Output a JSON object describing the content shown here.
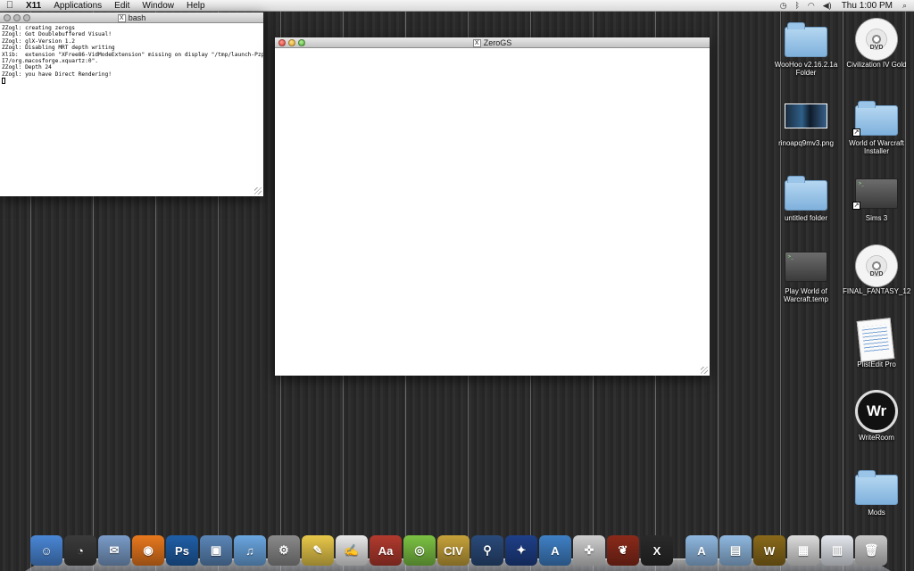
{
  "menubar": {
    "app": "X11",
    "items": [
      "Applications",
      "Edit",
      "Window",
      "Help"
    ],
    "clock": "Thu 1:00 PM"
  },
  "terminal": {
    "title": "bash",
    "lines": [
      "ZZogl: creating zerogs",
      "ZZogl: Got Doublebuffered Visual!",
      "ZZogl: glX-Version 1.2",
      "ZZogl: Disabling MRT depth writing",
      "Xlib:  extension \"XFree86-VidModeExtension\" missing on display \"/tmp/launch-Pzpp",
      "I7/org.macosforge.xquartz:0\".",
      "ZZogl: Depth 24",
      "ZZogl: you have Direct Rendering!"
    ]
  },
  "zerogs": {
    "title": "ZeroGS"
  },
  "desktop_icons": [
    {
      "label": "WooHoo v2.16.2.1a Folder",
      "icon": "folder-icon"
    },
    {
      "label": "Civilization IV Gold",
      "icon": "dvd-icon"
    },
    {
      "label": "rinoapq9mv3.png",
      "icon": "image-file-icon"
    },
    {
      "label": "World of Warcraft Installer",
      "icon": "folder-alias-icon"
    },
    {
      "label": "untitled folder",
      "icon": "folder-icon"
    },
    {
      "label": "Sims 3",
      "icon": "terminal-alias-icon"
    },
    {
      "label": "Play World of Warcraft.temp",
      "icon": "terminal-icon"
    },
    {
      "label": "FINAL_FANTASY_12",
      "icon": "dvd-icon"
    },
    {
      "label": "PlistEdit Pro",
      "icon": "plistedit-icon"
    },
    {
      "label": "WriteRoom",
      "icon": "writeroom-icon"
    },
    {
      "label": "Mods",
      "icon": "folder-icon"
    }
  ],
  "icon_text": {
    "dvd": "DVD",
    "writeroom": "Wr",
    "alias": "↗"
  },
  "dock": [
    {
      "name": "finder-icon",
      "color": "#4a87d6",
      "glyph": "☺"
    },
    {
      "name": "dashboard-icon",
      "color": "#3b3b3b",
      "glyph": "◔"
    },
    {
      "name": "mail-icon",
      "color": "#7a9cc8",
      "glyph": "✉"
    },
    {
      "name": "firefox-icon",
      "color": "#e8781e",
      "glyph": "◉"
    },
    {
      "name": "photoshop-icon",
      "color": "#1f5fa8",
      "glyph": "Ps"
    },
    {
      "name": "iphoto-icon",
      "color": "#5b86b8",
      "glyph": "▣"
    },
    {
      "name": "itunes-icon",
      "color": "#6aa6e0",
      "glyph": "♫"
    },
    {
      "name": "system-preferences-icon",
      "color": "#8a8a8a",
      "glyph": "⚙"
    },
    {
      "name": "stickies-icon",
      "color": "#e8c84a",
      "glyph": "✎"
    },
    {
      "name": "textedit-icon",
      "color": "#e9e9e9",
      "glyph": "✍"
    },
    {
      "name": "dictionary-icon",
      "color": "#b23a2e",
      "glyph": "Aa"
    },
    {
      "name": "lime-icon",
      "color": "#7cc243",
      "glyph": "◎"
    },
    {
      "name": "civ-icon",
      "color": "#c6a23a",
      "glyph": "CIV"
    },
    {
      "name": "joystick-icon",
      "color": "#2a4a7a",
      "glyph": "⚲"
    },
    {
      "name": "game-emblem-icon",
      "color": "#1e3f88",
      "glyph": "✦"
    },
    {
      "name": "app-store-icon",
      "color": "#3f80c6",
      "glyph": "A"
    },
    {
      "name": "gamepad-icon",
      "color": "#cfcfcf",
      "glyph": "✜"
    },
    {
      "name": "dragon-icon",
      "color": "#8a2a1a",
      "glyph": "❦"
    },
    {
      "name": "x11-icon",
      "color": "#2a2a2a",
      "glyph": "X"
    },
    {
      "name": "separator",
      "color": "",
      "glyph": ""
    },
    {
      "name": "applications-folder-icon",
      "color": "#8fb8e0",
      "glyph": "A"
    },
    {
      "name": "documents-folder-icon",
      "color": "#8fb8e0",
      "glyph": "▤"
    },
    {
      "name": "warcraft-icon",
      "color": "#8a6a1a",
      "glyph": "W"
    },
    {
      "name": "screenshot-stack-icon",
      "color": "#dcdcdc",
      "glyph": "▦"
    },
    {
      "name": "downloads-stack-icon",
      "color": "#e4e8ee",
      "glyph": "▥"
    },
    {
      "name": "trash-icon",
      "color": "#c9c9c9",
      "glyph": "🗑"
    }
  ]
}
